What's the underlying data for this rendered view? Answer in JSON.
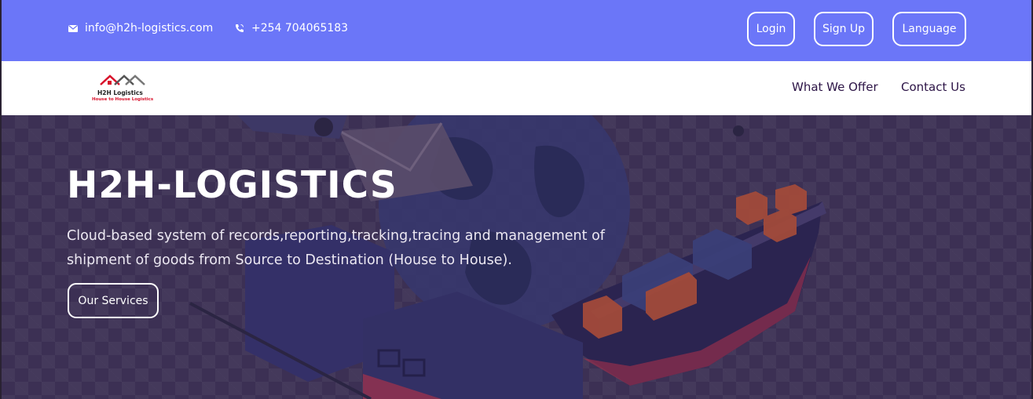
{
  "topbar": {
    "email": "info@h2h-logistics.com",
    "email_icon": "mail-icon",
    "phone": "+254 704065183",
    "phone_icon": "phone-icon",
    "login_label": "Login",
    "signup_label": "Sign Up",
    "language_label": "Language",
    "bg_color": "#6b76f8"
  },
  "navbar": {
    "logo_title": "H2H Logistics",
    "logo_tagline": "House to House Logistics",
    "links": [
      "What We Offer",
      "Contact Us"
    ]
  },
  "hero": {
    "title": "H2H-LOGISTICS",
    "description": "Cloud-based system of records,reporting,tracking,tracing and management of shipment of goods from Source to Destination (House to House).",
    "cta_label": "Our Services",
    "overlay_color": "#3c3054"
  }
}
